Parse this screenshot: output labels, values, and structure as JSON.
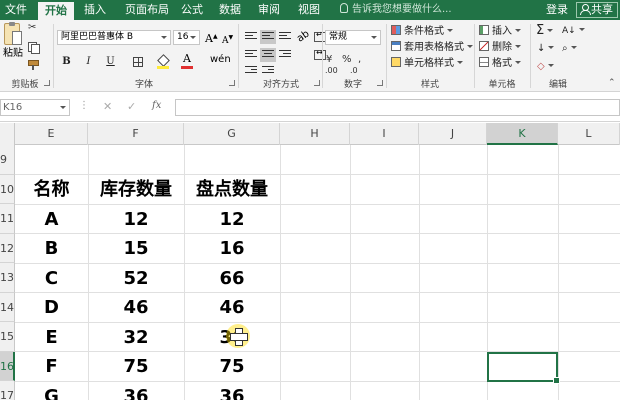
{
  "tabs": [
    "文件",
    "开始",
    "插入",
    "页面布局",
    "公式",
    "数据",
    "审阅",
    "视图"
  ],
  "active_tab": "开始",
  "tell_me_placeholder": "告诉我您想要做什么...",
  "account": {
    "login": "登录",
    "share": "共享"
  },
  "ribbon": {
    "clipboard": {
      "paste": "粘贴",
      "label": "剪贴板"
    },
    "font": {
      "name": "阿里巴巴普惠体 B",
      "size": "16",
      "grow": "A",
      "shrink": "A",
      "bold": "B",
      "italic": "I",
      "underline": "U",
      "font_color_letter": "A",
      "phonetic": "wén",
      "label": "字体"
    },
    "alignment": {
      "label": "对齐方式",
      "orientation": "ab"
    },
    "number": {
      "format": "常规",
      "percent": "%",
      "comma": ",",
      "currency": "¥",
      "inc_decimal": ".00",
      "dec_decimal": ".0",
      "label": "数字"
    },
    "styles": {
      "conditional": "条件格式",
      "table": "套用表格格式",
      "cell": "单元格样式",
      "label": "样式"
    },
    "cells": {
      "insert": "插入",
      "delete": "删除",
      "format": "格式",
      "label": "单元格"
    },
    "editing": {
      "sum": "Σ",
      "sort": "A↓",
      "fill": "↓",
      "find": "⌕",
      "clear": "◇",
      "label": "编辑"
    }
  },
  "formula_bar": {
    "name_box": "K16",
    "dots": "⋮",
    "cancel": "✕",
    "enter": "✓",
    "fx": "fx",
    "content": ""
  },
  "grid": {
    "columns": [
      "E",
      "F",
      "G",
      "H",
      "I",
      "J",
      "K",
      "L"
    ],
    "selected_column": "K",
    "rows": [
      "9",
      "10",
      "11",
      "12",
      "13",
      "14",
      "15",
      "16",
      "17"
    ],
    "selected_row": "16",
    "headers": [
      "名称",
      "库存数量",
      "盘点数量"
    ],
    "data": [
      [
        "A",
        "12",
        "12"
      ],
      [
        "B",
        "15",
        "16"
      ],
      [
        "C",
        "52",
        "66"
      ],
      [
        "D",
        "46",
        "46"
      ],
      [
        "E",
        "32",
        "36"
      ],
      [
        "F",
        "75",
        "75"
      ],
      [
        "G",
        "36",
        "36"
      ]
    ]
  },
  "colors": {
    "brand": "#217346",
    "ribbon_bg": "#f3f3f3",
    "highlight": "#ffdc00"
  }
}
